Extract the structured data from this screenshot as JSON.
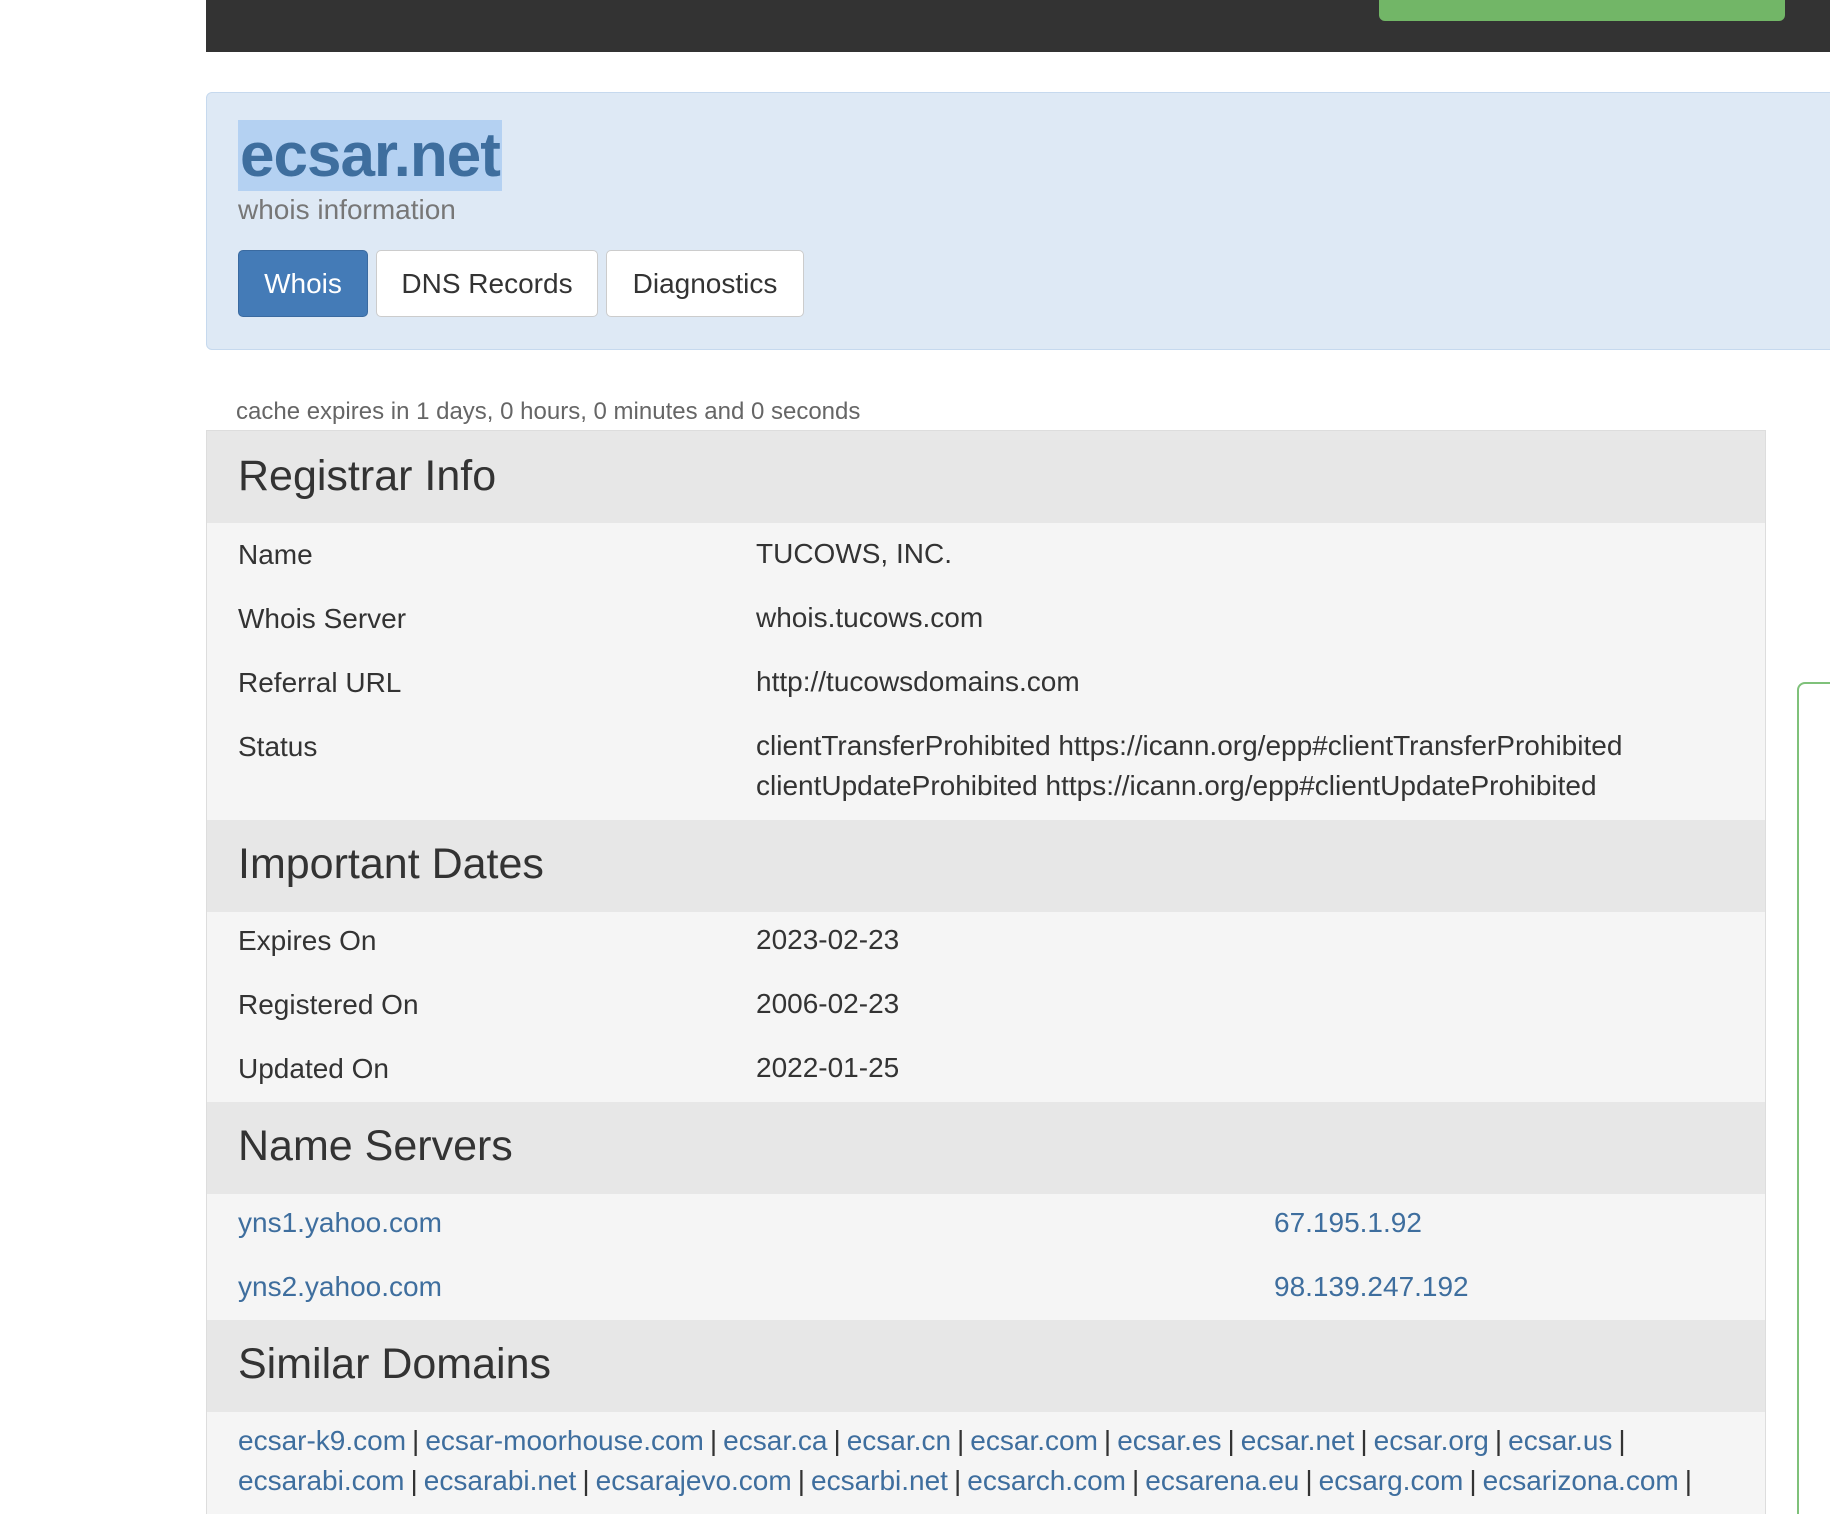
{
  "domain": {
    "name": "ecsar.net",
    "subtitle": "whois information"
  },
  "tabs": [
    {
      "label": "Whois"
    },
    {
      "label": "DNS Records"
    },
    {
      "label": "Diagnostics"
    }
  ],
  "cache_note": "cache expires in 1 days, 0 hours, 0 minutes and 0 seconds",
  "registrar": {
    "title": "Registrar Info",
    "name_label": "Name",
    "name_value": "TUCOWS, INC.",
    "whois_label": "Whois Server",
    "whois_value": "whois.tucows.com",
    "referral_label": "Referral URL",
    "referral_value": "http://tucowsdomains.com",
    "status_label": "Status",
    "status_line1": "clientTransferProhibited https://icann.org/epp#clientTransferProhibited",
    "status_line2": "clientUpdateProhibited https://icann.org/epp#clientUpdateProhibited"
  },
  "dates": {
    "title": "Important Dates",
    "expires_label": "Expires On",
    "expires_value": "2023-02-23",
    "registered_label": "Registered On",
    "registered_value": "2006-02-23",
    "updated_label": "Updated On",
    "updated_value": "2022-01-25"
  },
  "nameservers": {
    "title": "Name Servers",
    "items": [
      {
        "host": "yns1.yahoo.com",
        "ip": "67.195.1.92"
      },
      {
        "host": "yns2.yahoo.com",
        "ip": "98.139.247.192"
      }
    ]
  },
  "similar": {
    "title": "Similar Domains",
    "line1": [
      "ecsar-k9.com",
      "ecsar-moorhouse.com",
      "ecsar.ca",
      "ecsar.cn",
      "ecsar.com",
      "ecsar.es",
      "ecsar.net",
      "ecsar.org",
      "ecsar.us"
    ],
    "line2": [
      "ecsarabi.com",
      "ecsarabi.net",
      "ecsarajevo.com",
      "ecsarbi.net",
      "ecsarch.com",
      "ecsarena.eu",
      "ecsarg.com",
      "ecsarizona.com"
    ]
  },
  "colors": {
    "navbar": "#333333",
    "accent_green": "#72b667",
    "primary_button": "#447bb7",
    "link": "#3e6e9e",
    "header_bg": "#dee9f5"
  }
}
